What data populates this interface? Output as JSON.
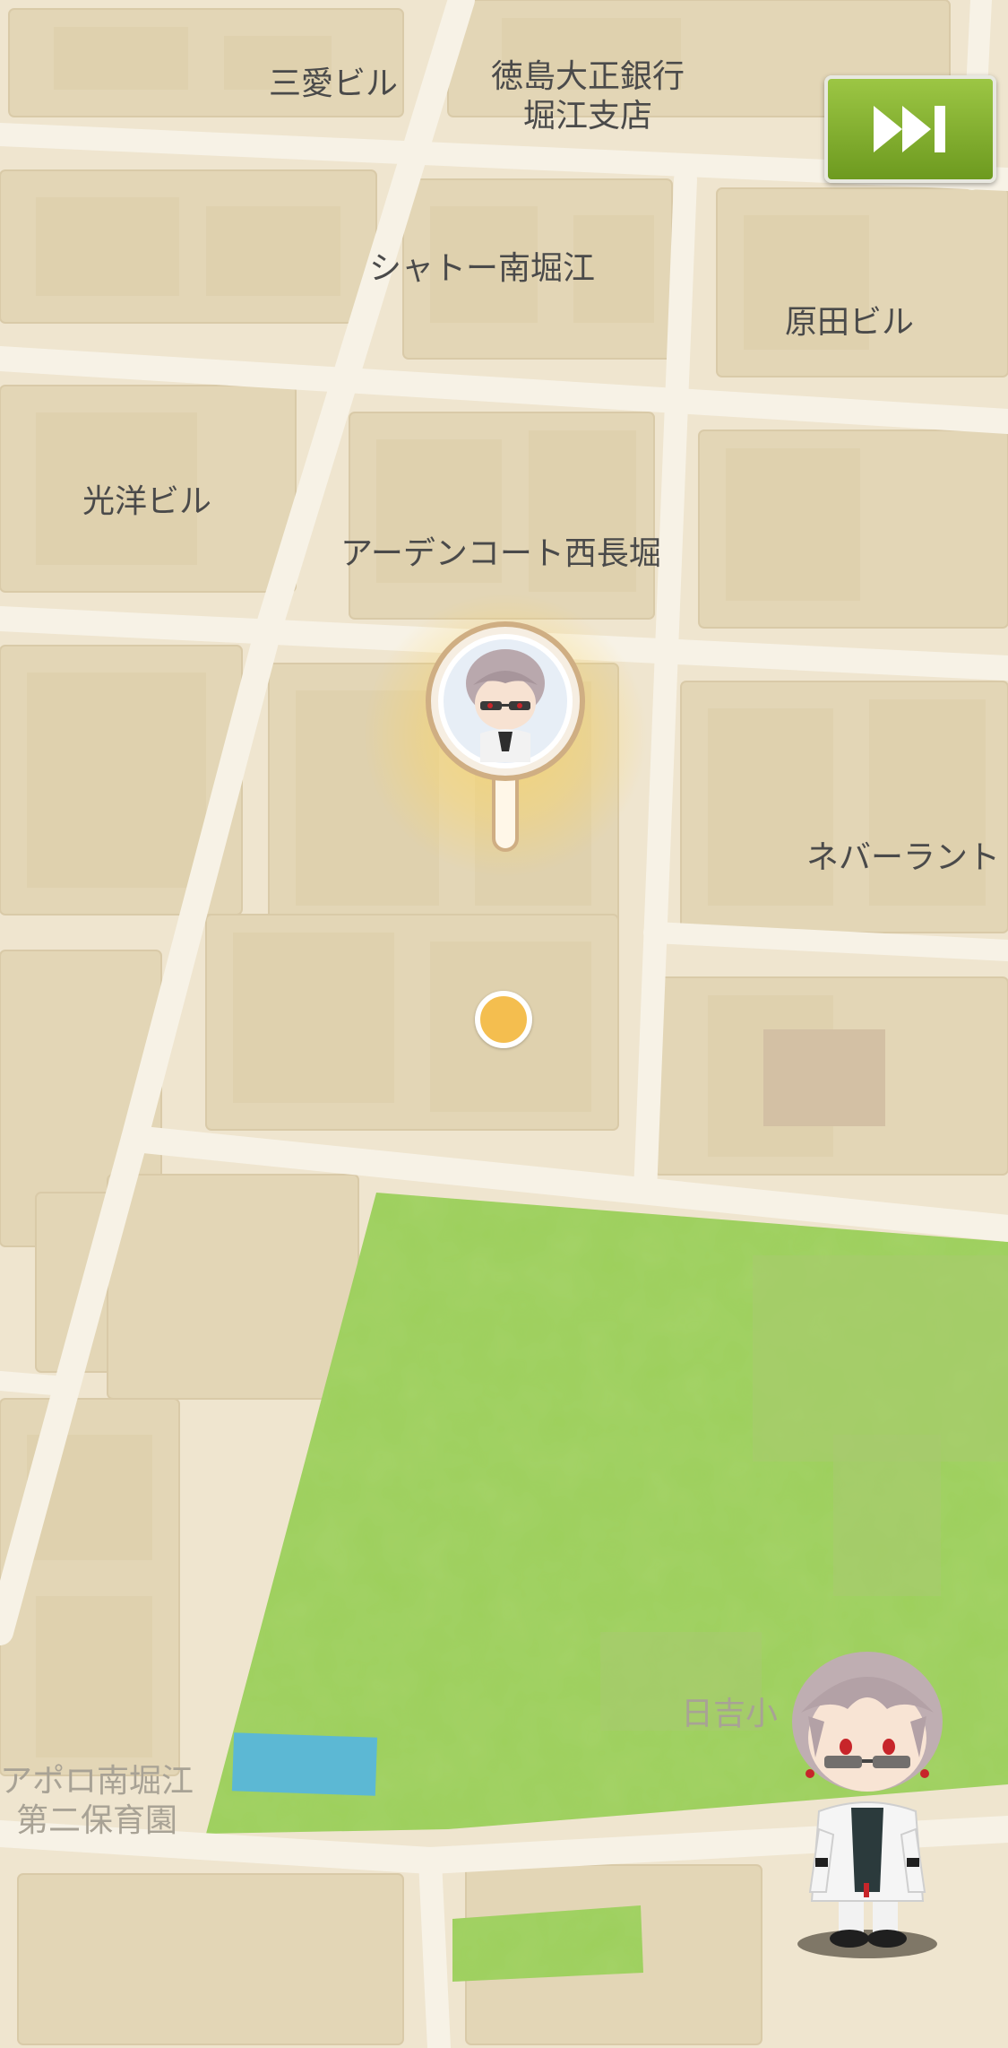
{
  "skip_button": {
    "icon": "fast-forward-icon"
  },
  "location_pin": {
    "icon": "character-avatar-pin"
  },
  "current_location": {
    "icon": "location-dot",
    "color": "#f4be4f"
  },
  "character": {
    "icon": "chibi-character"
  },
  "colors": {
    "map_base": "#efe5cf",
    "building": "#e3d6b6",
    "road": "#f7f2e6",
    "park": "#9ccf5c",
    "water": "#5cb8d4",
    "button_green": "#7fad2b"
  },
  "labels": {
    "sanryo": "三愛ビル",
    "tokushima_bank_1": "徳島大正銀行",
    "tokushima_bank_2": "堀江支店",
    "chateau": "シャトー南堀江",
    "harada": "原田ビル",
    "koyo": "光洋ビル",
    "arden": "アーデンコート西長堀",
    "neverland": "ネバーラント",
    "hiyoshi": "日吉小",
    "apollo_1": "アポロ南堀江",
    "apollo_2": "第二保育園"
  }
}
